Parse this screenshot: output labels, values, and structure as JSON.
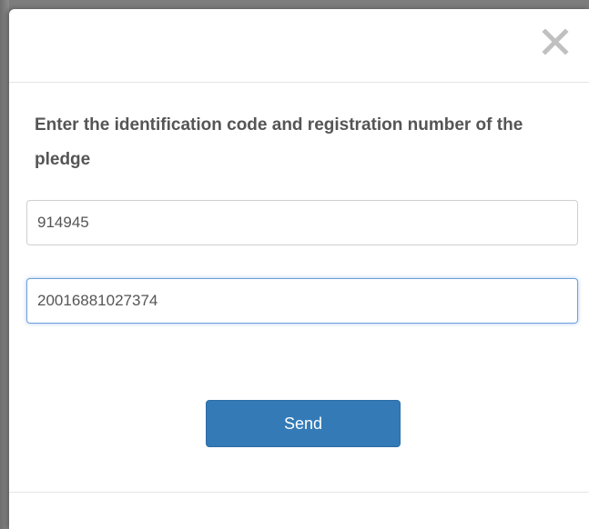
{
  "dialog": {
    "close_icon": "close-icon",
    "prompt": "Enter the identification code and registration number of the pledge",
    "identification_code": {
      "value": "914945"
    },
    "registration_number": {
      "value": "20016881027374"
    },
    "send_label": "Send"
  },
  "colors": {
    "primary_button": "#337ab7",
    "text": "#555555",
    "close_icon": "#c0c0c0",
    "focus_border": "#6fa0dc"
  }
}
